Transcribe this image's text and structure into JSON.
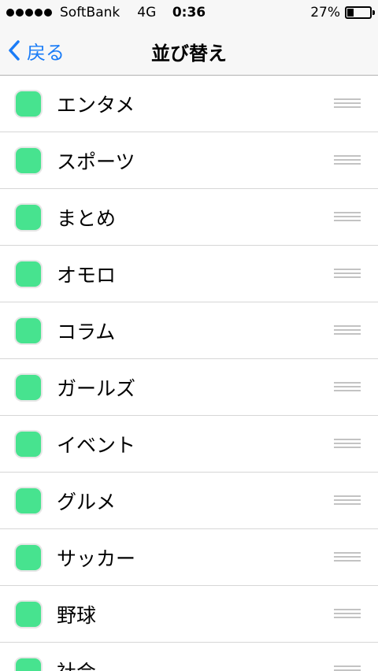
{
  "status_bar": {
    "carrier": "SoftBank",
    "network": "4G",
    "time": "0:36",
    "battery_percent": "27%",
    "battery_level": 0.27
  },
  "nav": {
    "back_label": "戻る",
    "title": "並び替え"
  },
  "accent_color": "#1a7cf7",
  "category_color": "#47e38f",
  "items": [
    {
      "label": "エンタメ"
    },
    {
      "label": "スポーツ"
    },
    {
      "label": "まとめ"
    },
    {
      "label": "オモロ"
    },
    {
      "label": "コラム"
    },
    {
      "label": "ガールズ"
    },
    {
      "label": "イベント"
    },
    {
      "label": "グルメ"
    },
    {
      "label": "サッカー"
    },
    {
      "label": "野球"
    },
    {
      "label": "社会"
    }
  ]
}
